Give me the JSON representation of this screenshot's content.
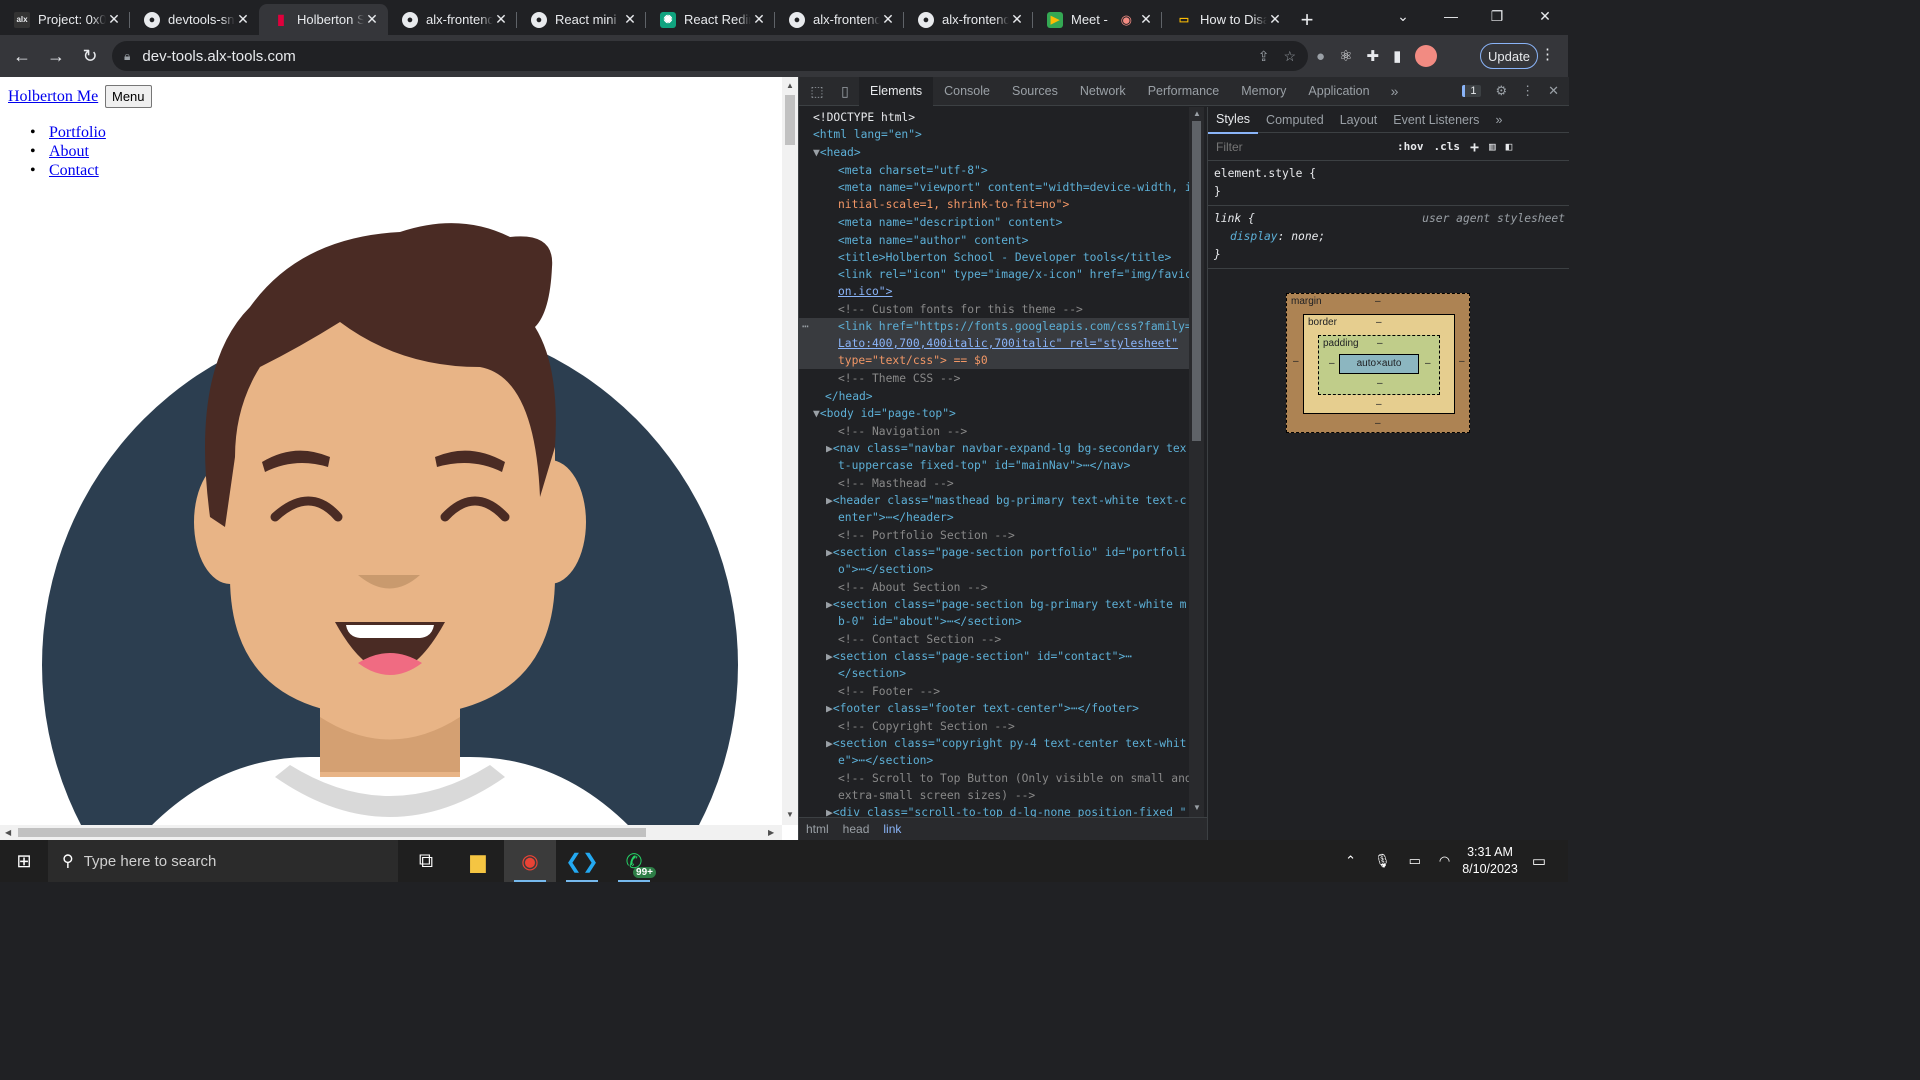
{
  "tabs": [
    {
      "title": "Project: 0x0",
      "favicon": "alx-favicon",
      "active": false
    },
    {
      "title": "devtools-sn",
      "favicon": "github-icon",
      "active": false
    },
    {
      "title": "Holberton S",
      "favicon": "holberton-favicon",
      "active": true
    },
    {
      "title": "alx-frontend",
      "favicon": "github-icon",
      "active": false
    },
    {
      "title": "React mini",
      "favicon": "github-icon",
      "active": false
    },
    {
      "title": "React Redir",
      "favicon": "chatgpt-icon",
      "active": false
    },
    {
      "title": "alx-frontend",
      "favicon": "github-icon",
      "active": false
    },
    {
      "title": "alx-frontend",
      "favicon": "github-icon",
      "active": false
    },
    {
      "title": "Meet -",
      "favicon": "meet-icon",
      "active": false
    },
    {
      "title": "How to Disa",
      "favicon": "monitor-icon",
      "active": false
    }
  ],
  "address": {
    "url": "dev-tools.alx-tools.com"
  },
  "toolbar": {
    "update_label": "Update"
  },
  "page": {
    "brand": "Holberton Me",
    "menu_button": "Menu",
    "nav": [
      "Portfolio",
      "About",
      "Contact"
    ],
    "colors": {
      "circle": "#2c3e50",
      "hair": "#4a2b24",
      "skin": "#e8b486"
    }
  },
  "devtools": {
    "tabs": [
      "Elements",
      "Console",
      "Sources",
      "Network",
      "Performance",
      "Memory",
      "Application"
    ],
    "issues_count": "1",
    "breadcrumbs": [
      "html",
      "head",
      "link"
    ],
    "styles_tabs": [
      "Styles",
      "Computed",
      "Layout",
      "Event Listeners"
    ],
    "filter_placeholder": "Filter",
    "hov": ":hov",
    "cls": ".cls",
    "element_style": "element.style {",
    "element_style_close": "}",
    "rule_selector": "link {",
    "rule_source": "user agent stylesheet",
    "rule_prop": "display",
    "rule_value": "none;",
    "rule_close": "}",
    "box": {
      "margin": "margin",
      "border": "border",
      "padding": "padding",
      "content": "auto×auto",
      "dash": "–"
    },
    "code_lines": [
      "<!DOCTYPE html>",
      "<html lang=\"en\">",
      "<head>",
      "<meta charset=\"utf-8\">",
      "<meta name=\"viewport\" content=\"width=device-width, i",
      "nitial-scale=1, shrink-to-fit=no\">",
      "<meta name=\"description\" content>",
      "<meta name=\"author\" content>",
      "<title>Holberton School - Developer tools</title>",
      "<link rel=\"icon\" type=\"image/x-icon\" href=\"img/favic",
      "on.ico\">",
      "<!-- Custom fonts for this theme -->",
      "<link href=\"https://fonts.googleapis.com/css?family=",
      "Lato:400,700,400italic,700italic\" rel=\"stylesheet\"",
      "type=\"text/css\"> == $0",
      "<!-- Theme CSS -->",
      "</head>",
      "<body id=\"page-top\">",
      "<!-- Navigation -->",
      "<nav class=\"navbar navbar-expand-lg bg-secondary tex",
      "t-uppercase fixed-top\" id=\"mainNav\">⋯</nav>",
      "<!-- Masthead -->",
      "<header class=\"masthead bg-primary text-white text-c",
      "enter\">⋯</header>",
      "<!-- Portfolio Section -->",
      "<section class=\"page-section portfolio\" id=\"portfoli",
      "o\">⋯</section>",
      "<!-- About Section -->",
      "<section class=\"page-section bg-primary text-white m",
      "b-0\" id=\"about\">⋯</section>",
      "<!-- Contact Section -->",
      "<section class=\"page-section\" id=\"contact\">⋯",
      "</section>",
      "<!-- Footer -->",
      "<footer class=\"footer text-center\">⋯</footer>",
      "<!-- Copyright Section -->",
      "<section class=\"copyright py-4 text-center text-whit",
      "e\">⋯</section>",
      "<!-- Scroll to Top Button (Only visible on small and",
      "extra-small screen sizes) -->",
      "<div class=\"scroll-to-top d-lg-none position-fixed \""
    ]
  },
  "taskbar": {
    "search_placeholder": "Type here to search",
    "time": "3:31 AM",
    "date": "8/10/2023",
    "whatsapp_badge": "99+"
  }
}
